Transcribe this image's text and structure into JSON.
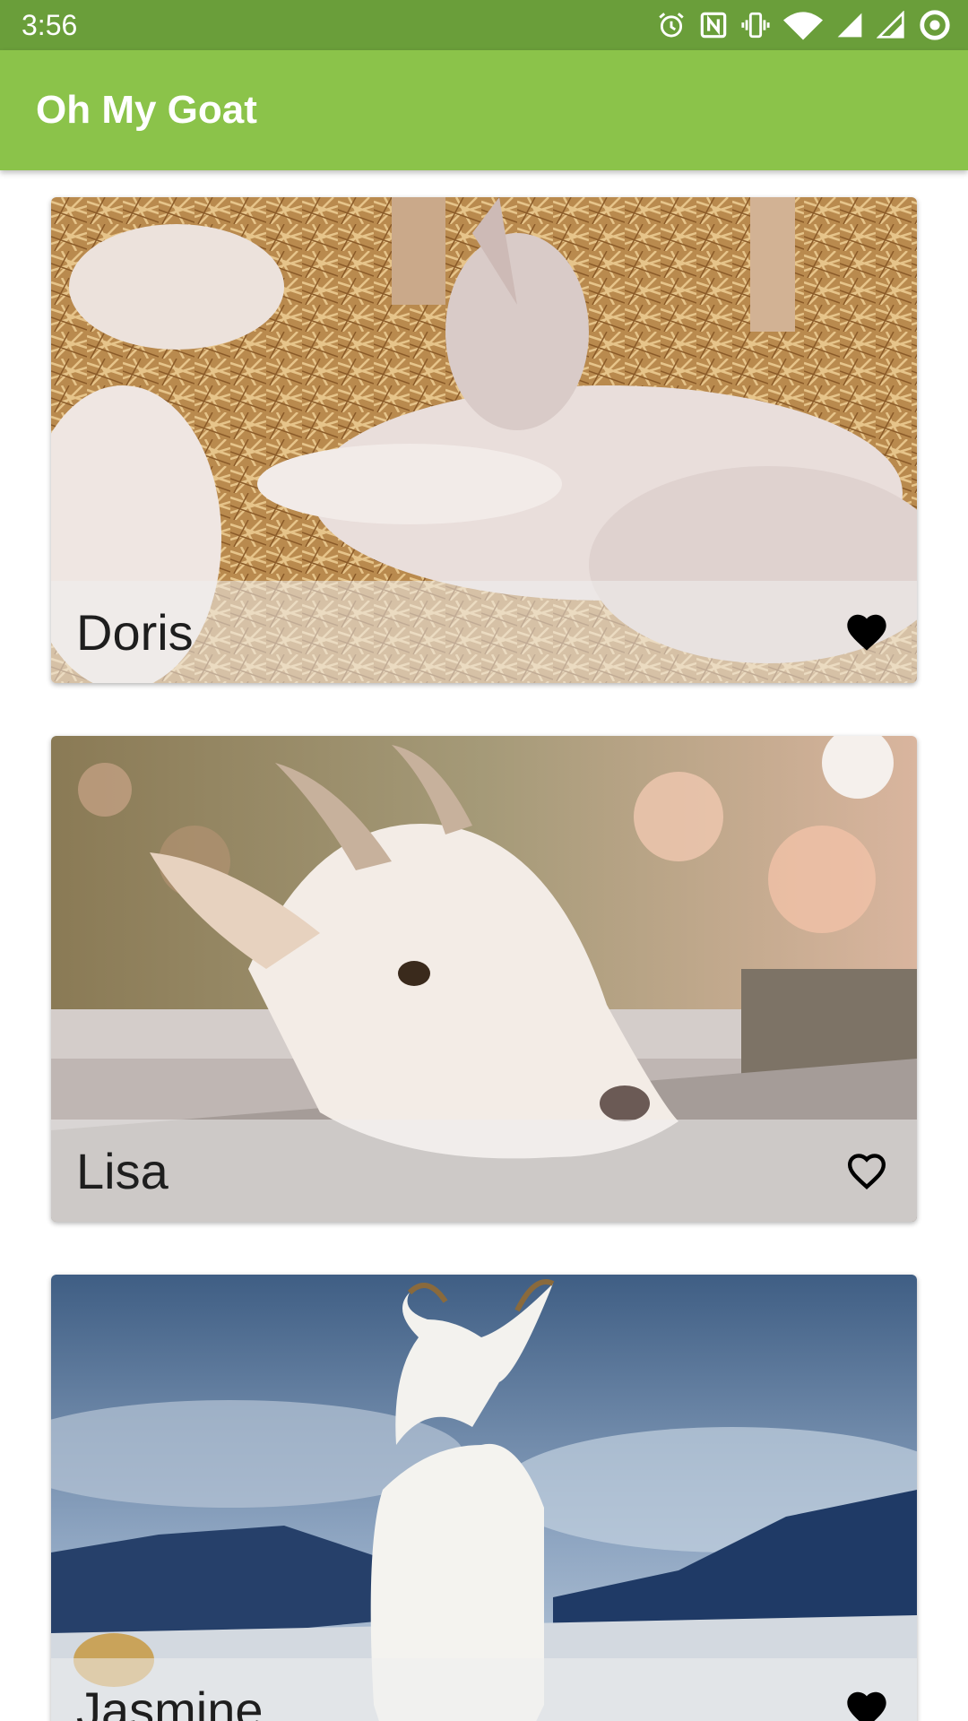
{
  "status_bar": {
    "time": "3:56",
    "icons": [
      "alarm-icon",
      "nfc-icon",
      "vibrate-icon",
      "wifi-icon",
      "signal-icon",
      "signal-icon-2",
      "circle-icon"
    ]
  },
  "app_bar": {
    "title": "Oh My Goat",
    "color": "#8bc34a",
    "status_color": "#6a9e3a"
  },
  "goats": [
    {
      "name": "Doris",
      "favorite": true,
      "image": "sleeping-kid-goats-on-hay"
    },
    {
      "name": "Lisa",
      "favorite": false,
      "image": "goat-head-over-fence"
    },
    {
      "name": "Jasmine",
      "favorite": true,
      "image": "white-goat-with-mountains"
    }
  ]
}
